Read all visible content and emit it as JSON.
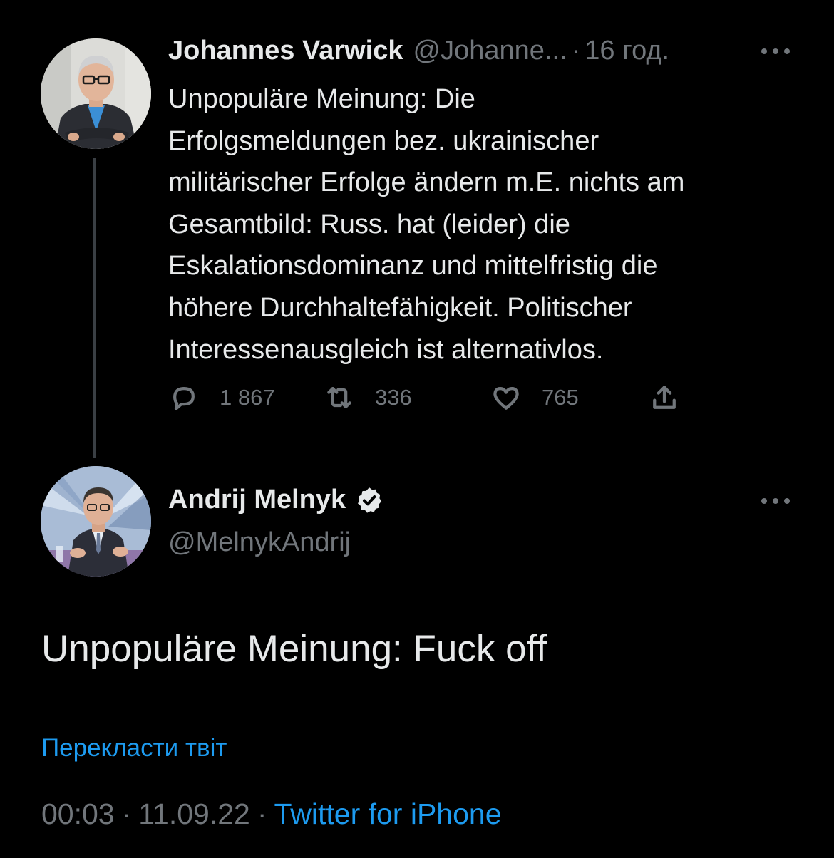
{
  "parent_tweet": {
    "display_name": "Johannes Varwick",
    "handle": "@Johanne...",
    "separator": "·",
    "time_ago": "16 год.",
    "text": "Unpopuläre Meinung: Die\nErfolgsmeldungen bez. ukrainischer\nmilitärischer Erfolge ändern m.E. nichts am\nGesamtbild: Russ. hat (leider) die\nEskalationsdominanz und  mittelfristig die\nhöhere Durchhaltefähigkeit. Politischer\nInteressenausgleich ist alternativlos.",
    "stats": {
      "replies": "1 867",
      "retweets": "336",
      "likes": "765"
    },
    "icons": [
      "more-icon",
      "reply-icon",
      "retweet-icon",
      "like-icon",
      "share-icon"
    ]
  },
  "main_tweet": {
    "display_name": "Andrij Melnyk",
    "handle": "@MelnykAndrij",
    "verified": true,
    "text": "Unpopuläre Meinung: Fuck off",
    "translate_label": "Перекласти твіт",
    "time": "00:03",
    "separator": "·",
    "date": "11.09.22",
    "source": "Twitter for iPhone",
    "icons": [
      "verified-icon",
      "more-icon"
    ]
  },
  "colors": {
    "background": "#000000",
    "primary_text": "#e7e9ea",
    "secondary_text": "#71767b",
    "link": "#1d9bf0",
    "thread_line": "#3a3f44"
  }
}
